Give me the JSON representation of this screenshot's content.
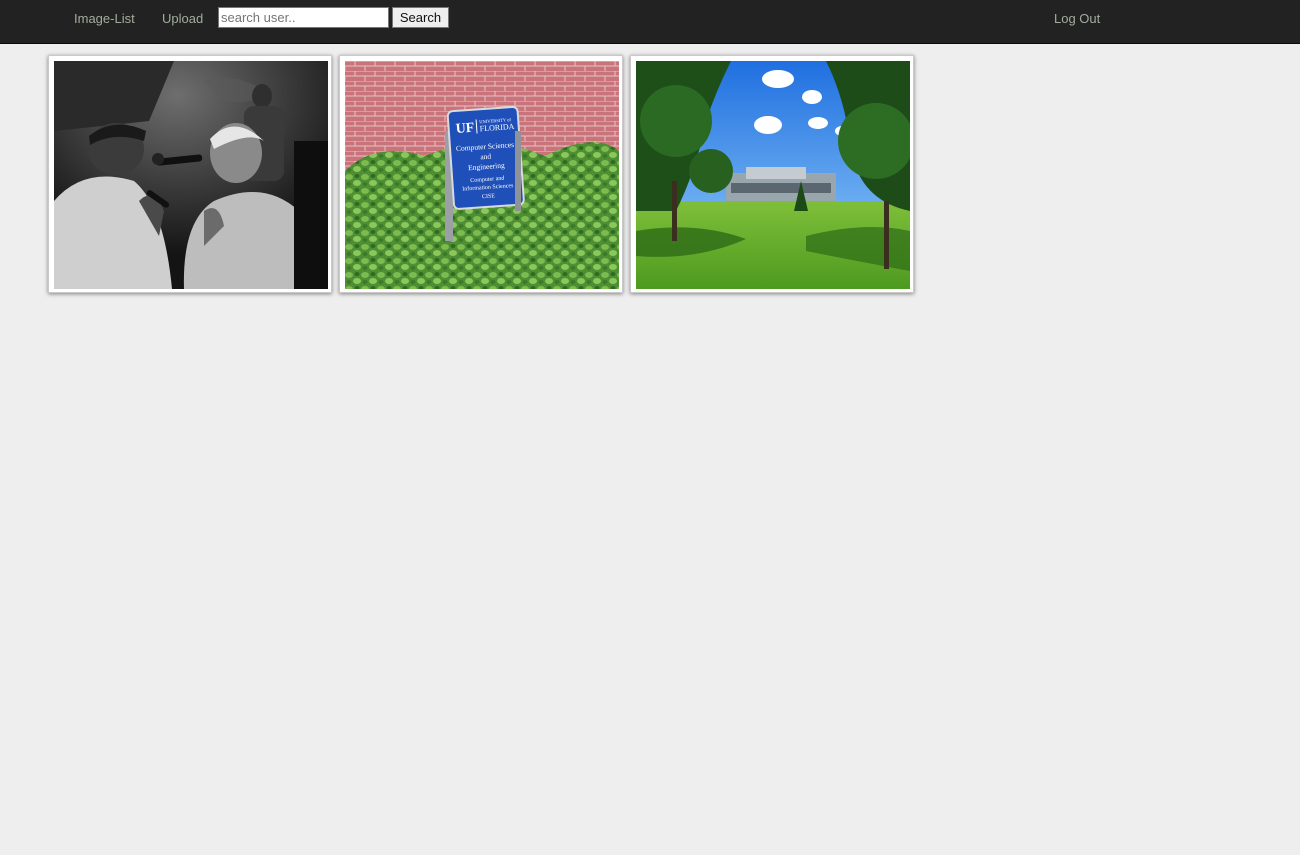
{
  "nav": {
    "image_list_label": "Image-List",
    "upload_label": "Upload",
    "logout_label": "Log Out"
  },
  "search": {
    "placeholder": "search user..",
    "button_label": "Search"
  },
  "gallery": {
    "images": [
      {
        "subject": "black-and-white concert photo of two performers with microphones"
      },
      {
        "subject": "blue sign in front of brick wall and shrubs"
      },
      {
        "subject": "campus lawn with trees and building under blue sky"
      }
    ]
  },
  "sign": {
    "logo": "UF",
    "logo_caption_top": "UNIVERSITY of",
    "logo_caption": "FLORIDA",
    "line1": "Computer Sciences",
    "line2": "and",
    "line3": "Engineering",
    "line4": "Computer and",
    "line5": "Information Sciences",
    "line6": "CISE"
  },
  "colors": {
    "navbar_bg": "#222222",
    "nav_link": "#a3ac9d",
    "page_bg": "#eeeeee"
  }
}
